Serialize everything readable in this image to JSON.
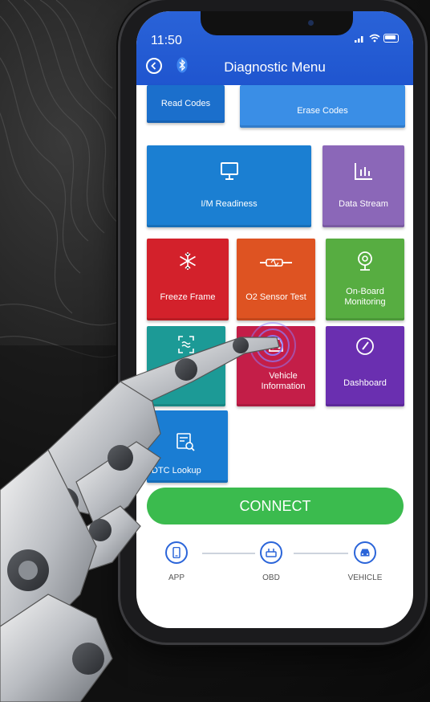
{
  "status_bar": {
    "time": "11:50"
  },
  "header": {
    "title": "Diagnostic Menu"
  },
  "tiles": {
    "read_codes": "Read Codes",
    "erase_codes": "Erase Codes",
    "im_readiness": "I/M Readiness",
    "data_stream": "Data Stream",
    "freeze_frame": "Freeze Frame",
    "o2_sensor_test": "O2 Sensor Test",
    "onboard_monitoring": "On-Board Monitoring",
    "vehicle_information": "Vehicle Information",
    "dashboard": "Dashboard",
    "dtc_lookup": "DTC Lookup"
  },
  "connect": {
    "label": "CONNECT"
  },
  "flow": {
    "app": "APP",
    "obd": "OBD",
    "vehicle": "VEHICLE"
  },
  "colors": {
    "header": "#1f55cf",
    "blue_tile": "#1b78cf",
    "purple_tile": "#8b67b8",
    "red_tile": "#d3212b",
    "orange_tile": "#de5322",
    "green_tile": "#57ad41",
    "teal_tile": "#1c9a96",
    "crimson_tile": "#c41e48",
    "violet_tile": "#6a2fb0",
    "connect": "#3bbb4e"
  }
}
